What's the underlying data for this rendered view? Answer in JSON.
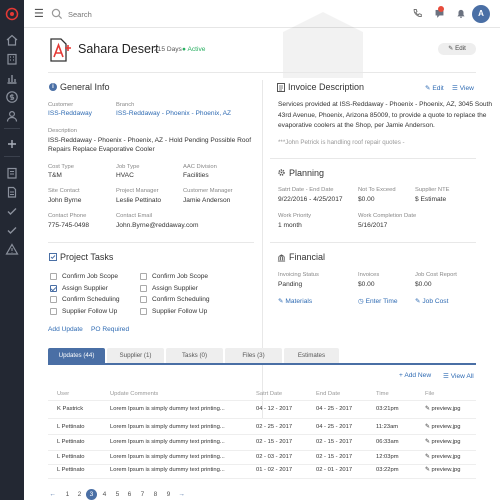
{
  "colors": {
    "sidebar": "#232833",
    "accent": "#4a6fa5",
    "link": "#2f6bb3",
    "active_status": "#27ae60",
    "notification": "#e74c3c",
    "logo": "#e53935"
  },
  "sidebar": {
    "items": [
      {
        "icon": "target-logo-icon"
      },
      {
        "icon": "home-icon"
      },
      {
        "icon": "building-icon"
      },
      {
        "icon": "chart-icon"
      },
      {
        "icon": "dollar-icon"
      },
      {
        "icon": "user-icon"
      },
      {
        "icon": "plus-icon"
      },
      {
        "icon": "list-icon"
      },
      {
        "icon": "document-icon"
      },
      {
        "icon": "check-icon"
      },
      {
        "icon": "check-icon"
      },
      {
        "icon": "warning-icon"
      }
    ]
  },
  "topbar": {
    "search_placeholder": "Search",
    "avatar_initial": "A",
    "icons": [
      "menu-icon",
      "search-icon",
      "phone-icon",
      "chat-icon",
      "bell-icon"
    ]
  },
  "header": {
    "title": "Sahara Desert",
    "days": "215 Days",
    "status": "Active",
    "edit": "Edit",
    "logo_icon": "a-plus-logo"
  },
  "general_info": {
    "title": "General Info",
    "customer_label": "Customer",
    "customer": "ISS-Reddaway",
    "branch_label": "Branch",
    "branch": "ISS-Reddaway - Phoenix - Phoenix, AZ",
    "description_label": "Description",
    "description_line1": "ISS-Reddaway - Phoenix - Phoenix, AZ - Hold Pending Possible Roof",
    "description_line2": "Repairs Replace Evaporative Cooler",
    "cost_type_label": "Cost Type",
    "cost_type": "T&M",
    "job_type_label": "Job Type",
    "job_type": "HVAC",
    "aac_division_label": "AAC Division",
    "aac_division": "Facilities",
    "site_contact_label": "Site Contact",
    "site_contact": "John Byrne",
    "project_manager_label": "Project Manager",
    "project_manager": "Leslie Pettinato",
    "customer_manager_label": "Customer Manager",
    "customer_manager": "Jamie Anderson",
    "contact_phone_label": "Contact Phone",
    "contact_phone": "775-745-0498",
    "contact_email_label": "Contact Email",
    "contact_email": "John.Byrne@reddaway.com"
  },
  "invoice": {
    "title": "Invoice Description",
    "edit": "Edit",
    "view": "View",
    "line1": "Services provided at ISS-Reddaway - Phoenix - Phoenix, AZ, 3045 South",
    "line2": "43rd Avenue, Phoenix, Arizona 85009, to provide a quote to replace the",
    "line3": "evaporative coolers at the Shop, per Jamie Anderson.",
    "note": "***John Petrick is handling roof repair quotes -"
  },
  "planning": {
    "title": "Planning",
    "start_end_label": "Satrt Date - End Date",
    "start_end": "9/22/2016 - 4/25/2017",
    "not_to_exceed_label": "Not To Exceed",
    "not_to_exceed": "$0.00",
    "supplier_nte_label": "Supplier NTE",
    "supplier_nte": "$ Estimate",
    "work_priority_label": "Work Priority",
    "work_priority": "1 month",
    "work_completion_label": "Work Completion Date",
    "work_completion": "5/16/2017"
  },
  "project_tasks": {
    "title": "Project Tasks",
    "left": [
      {
        "label": "Confirm Job Scope",
        "checked": false
      },
      {
        "label": "Assign Supplier",
        "checked": true
      },
      {
        "label": "Confirm Scheduling",
        "checked": false
      },
      {
        "label": "Supplier Follow Up",
        "checked": false
      }
    ],
    "right": [
      {
        "label": "Confirm Job Scope",
        "checked": false
      },
      {
        "label": "Assign Supplier",
        "checked": false
      },
      {
        "label": "Confirm Scheduling",
        "checked": false
      },
      {
        "label": "Supplier Follow Up",
        "checked": false
      }
    ],
    "add_update": "Add Update",
    "po_required": "PO Required"
  },
  "financial": {
    "title": "Financial",
    "invoicing_status_label": "Invoicing Status",
    "invoicing_status": "Panding",
    "invoices_label": "Invoices",
    "invoices": "$0.00",
    "job_cost_report_label": "Job Cost Report",
    "job_cost_report": "$0.00",
    "materials": "Materials",
    "enter_time": "Enter Time",
    "job_cost": "Job Cost"
  },
  "tabs": [
    "Updates (44)",
    "Supplier (1)",
    "Tasks (0)",
    "Files (3)",
    "Estimates"
  ],
  "table": {
    "add_new": "Add New",
    "view_all": "View All",
    "headers": [
      "User",
      "Update Comments",
      "Satrt Date",
      "End Date",
      "Time",
      "File"
    ],
    "rows": [
      [
        "K Pastrick",
        "Lorem Ipsum is simply dummy text printing...",
        "04 - 12 - 2017",
        "04 - 25 - 2017",
        "03:21pm",
        "preview.jpg"
      ],
      [
        "L Pettinato",
        "Lorem Ipsum is simply dummy text printing...",
        "02 - 25 - 2017",
        "04 - 25 - 2017",
        "11:23am",
        "preview.jpg"
      ],
      [
        "L Pettinato",
        "Lorem Ipsum is simply dummy text printing...",
        "02 - 15 - 2017",
        "02 - 15 - 2017",
        "06:33am",
        "preview.jpg"
      ],
      [
        "L Pettinato",
        "Lorem Ipsum is simply dummy text printing...",
        "02 - 03 - 2017",
        "02 - 15 - 2017",
        "12:03pm",
        "preview.jpg"
      ],
      [
        "L Pettinato",
        "Lorem Ipsum is simply dummy text printing...",
        "01 - 02 - 2017",
        "02 - 01 - 2017",
        "03:22pm",
        "preview.jpg"
      ]
    ]
  },
  "pagination": {
    "prev": "←",
    "next": "→",
    "pages": [
      "1",
      "2",
      "3",
      "4",
      "5",
      "6",
      "7",
      "8",
      "9"
    ],
    "active_page": "3"
  }
}
